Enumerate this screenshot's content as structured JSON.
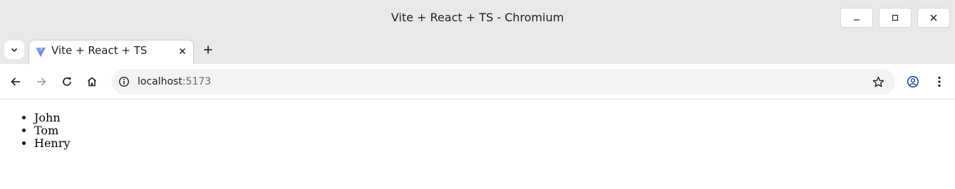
{
  "window": {
    "title": "Vite + React + TS - Chromium",
    "controls": {
      "minimize_icon": "minimize-icon",
      "maximize_icon": "maximize-icon",
      "close_icon": "close-icon"
    }
  },
  "tabs": [
    {
      "title": "Vite + React + TS",
      "favicon": "vite-logo-icon",
      "active": true
    }
  ],
  "toolbar": {
    "url_host": "localhost",
    "url_port": ":5173",
    "icons": [
      "back-arrow-icon",
      "forward-arrow-icon",
      "reload-icon",
      "home-icon",
      "info-icon",
      "star-icon",
      "profile-icon",
      "menu-icon"
    ]
  },
  "page": {
    "names": [
      "John",
      "Tom",
      "Henry"
    ]
  },
  "colors": {
    "chrome_bg": "#e9e9e9",
    "omnibox_bg": "#f1f3f4",
    "text": "#202124",
    "port_text": "#6b6b6b"
  }
}
